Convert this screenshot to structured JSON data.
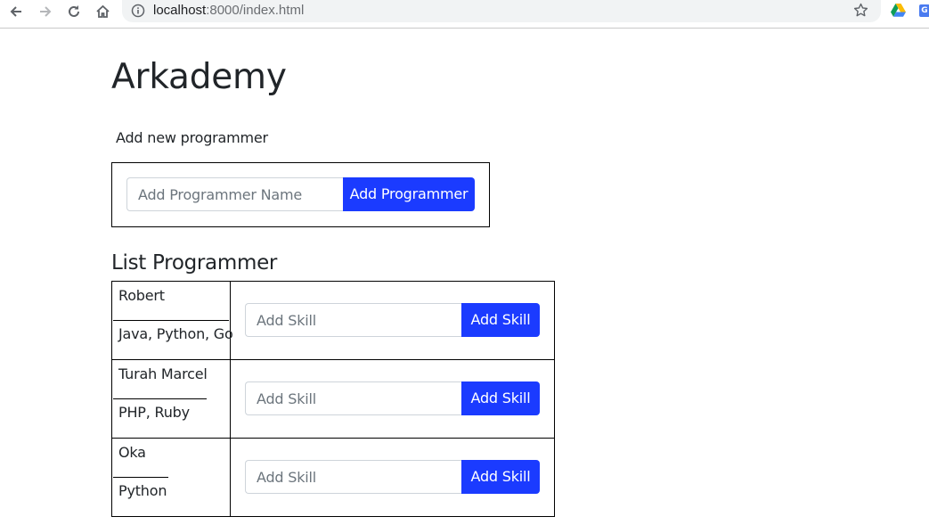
{
  "browser": {
    "url_host": "localhost",
    "url_rest": ":8000/index.html"
  },
  "page": {
    "title": "Arkademy",
    "add_section_label": "Add new programmer",
    "name_placeholder": "Add Programmer Name",
    "add_button_label": "Add Programmer",
    "list_title": "List Programmer"
  },
  "programmers": [
    {
      "name": "Robert",
      "skills": "Java, Python, Go",
      "skill_placeholder": "Add Skill",
      "add_skill_label": "Add Skill"
    },
    {
      "name": "Turah Marcel",
      "skills": "PHP, Ruby",
      "skill_placeholder": "Add Skill",
      "add_skill_label": "Add Skill"
    },
    {
      "name": "Oka",
      "skills": "Python",
      "skill_placeholder": "Add Skill",
      "add_skill_label": "Add Skill"
    }
  ],
  "colors": {
    "primary_button": "#1b3bff",
    "text": "#212529",
    "placeholder": "#6c757d"
  }
}
